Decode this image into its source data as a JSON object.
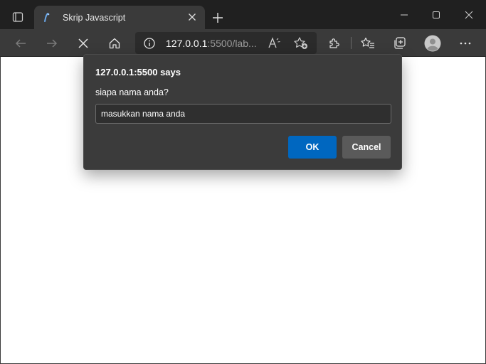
{
  "browser": {
    "tab": {
      "title": "Skrip Javascript"
    },
    "address": {
      "host": "127.0.0.1",
      "rest": ":5500/lab..."
    }
  },
  "dialog": {
    "title": "127.0.0.1:5500 says",
    "message": "siapa nama anda?",
    "input_value": "masukkan nama anda",
    "ok_label": "OK",
    "cancel_label": "Cancel"
  },
  "colors": {
    "accent": "#0067c0",
    "chrome_dark": "#202020",
    "toolbar": "#3a3a3a",
    "dialog_bg": "#3b3b3b"
  },
  "icons": [
    "tab-actions-icon",
    "page-favicon",
    "close-tab-icon",
    "new-tab-icon",
    "minimize-icon",
    "maximize-icon",
    "close-window-icon",
    "back-icon",
    "forward-icon",
    "stop-loading-icon",
    "home-icon",
    "site-info-icon",
    "read-aloud-icon",
    "add-favorite-icon",
    "extensions-icon",
    "favorites-icon",
    "collections-icon",
    "profile-avatar",
    "more-menu-icon"
  ]
}
